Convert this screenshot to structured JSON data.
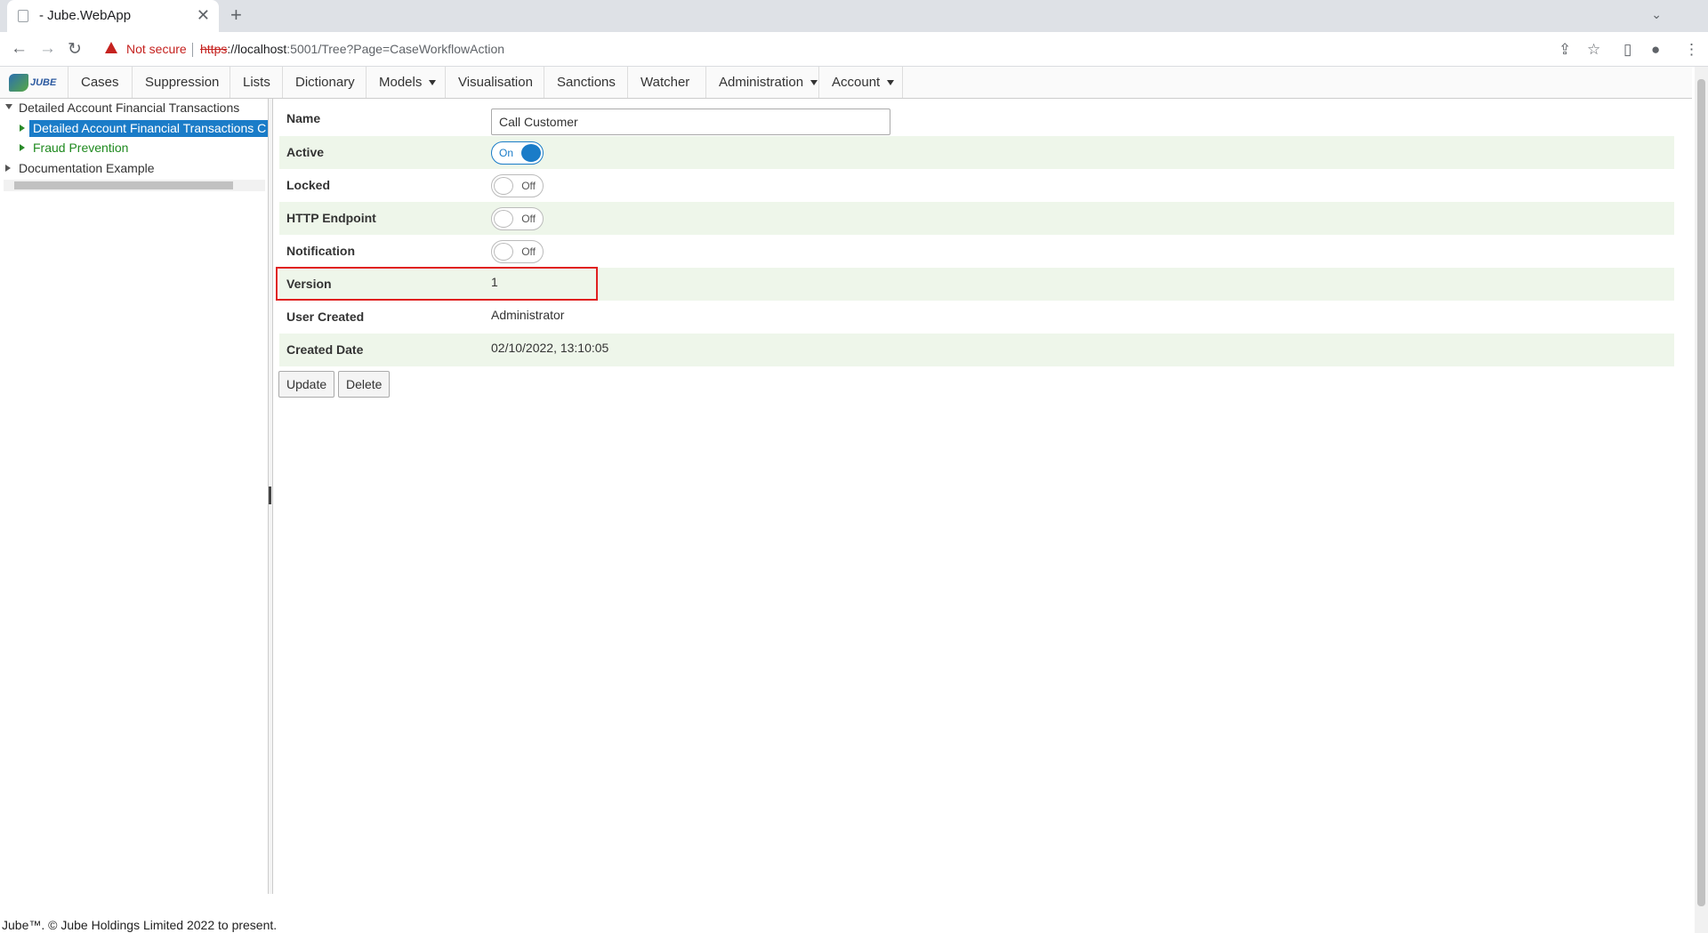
{
  "browser": {
    "tab_title": "- Jube.WebApp",
    "tab_close": "✕",
    "new_tab": "+",
    "not_secure": "Not secure",
    "url_scheme": "https",
    "url_host": "://localhost",
    "url_rest": ":5001/Tree?Page=CaseWorkflowAction"
  },
  "app_nav": {
    "logo_text": "JUBE",
    "items": [
      {
        "label": "Cases"
      },
      {
        "label": "Suppression"
      },
      {
        "label": "Lists"
      },
      {
        "label": "Dictionary"
      },
      {
        "label": "Models",
        "dropdown": true
      },
      {
        "label": "Visualisation"
      },
      {
        "label": "Sanctions"
      },
      {
        "label": "Watcher"
      },
      {
        "label": "Administration",
        "dropdown": true
      },
      {
        "label": "Account",
        "dropdown": true
      }
    ]
  },
  "tree": {
    "root1": "Detailed Account Financial Transactions",
    "selected": "Detailed Account Financial Transactions C",
    "child2": "Fraud Prevention",
    "root2": "Documentation Example"
  },
  "form": {
    "name_label": "Name",
    "name_value": "Call Customer",
    "active_label": "Active",
    "active_state": "On",
    "locked_label": "Locked",
    "locked_state": "Off",
    "http_label": "HTTP Endpoint",
    "http_state": "Off",
    "notification_label": "Notification",
    "notification_state": "Off",
    "version_label": "Version",
    "version_value": "1",
    "user_created_label": "User Created",
    "user_created_value": "Administrator",
    "created_date_label": "Created Date",
    "created_date_value": "02/10/2022, 13:10:05",
    "update_button": "Update",
    "delete_button": "Delete"
  },
  "footer": "Jube™. © Jube Holdings Limited 2022 to present.",
  "colors": {
    "selected_blue": "#1a7cc8",
    "row_green": "#eef6ea",
    "highlight_red": "#e02020"
  }
}
